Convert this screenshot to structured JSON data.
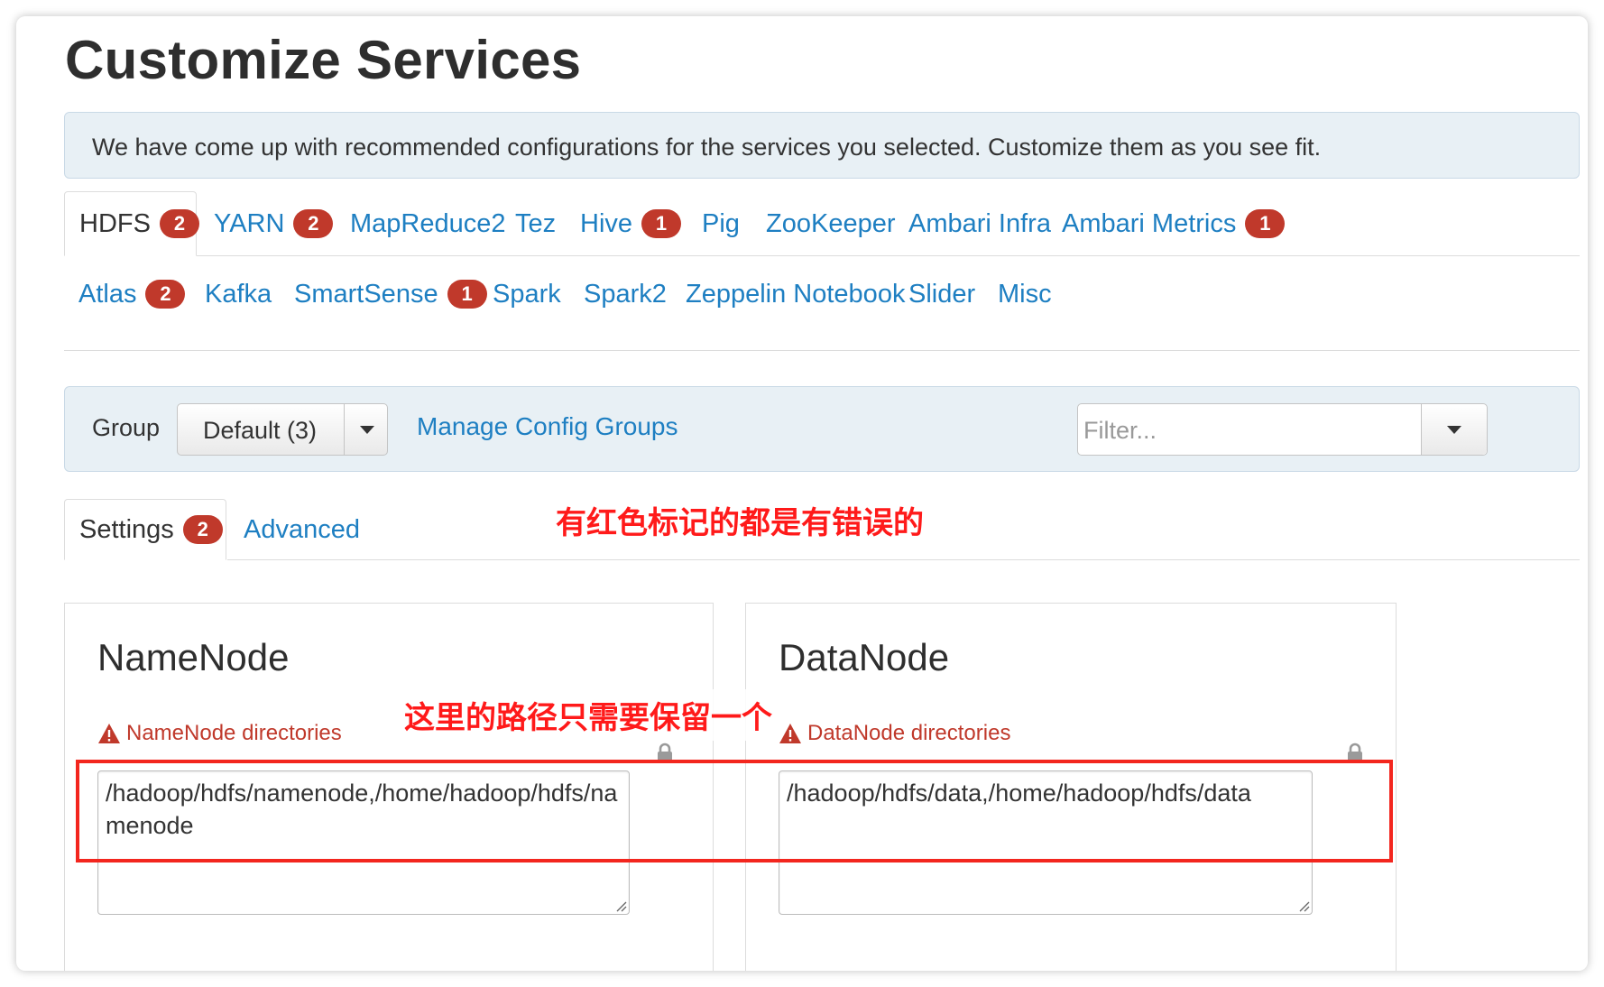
{
  "page_title": "Customize Services",
  "info_message": "We have come up with recommended configurations for the services you selected. Customize them as you see fit.",
  "service_tabs_row1": [
    {
      "label": "HDFS",
      "badge": "2",
      "active": true
    },
    {
      "label": "YARN",
      "badge": "2"
    },
    {
      "label": "MapReduce2",
      "badge": ""
    },
    {
      "label": "Tez",
      "badge": ""
    },
    {
      "label": "Hive",
      "badge": "1"
    },
    {
      "label": "Pig",
      "badge": ""
    },
    {
      "label": "ZooKeeper",
      "badge": ""
    },
    {
      "label": "Ambari Infra",
      "badge": ""
    },
    {
      "label": "Ambari Metrics",
      "badge": "1"
    }
  ],
  "service_tabs_row2": [
    {
      "label": "Atlas",
      "badge": "2"
    },
    {
      "label": "Kafka",
      "badge": ""
    },
    {
      "label": "SmartSense",
      "badge": "1"
    },
    {
      "label": "Spark",
      "badge": ""
    },
    {
      "label": "Spark2",
      "badge": ""
    },
    {
      "label": "Zeppelin Notebook",
      "badge": ""
    },
    {
      "label": "Slider",
      "badge": ""
    },
    {
      "label": "Misc",
      "badge": ""
    }
  ],
  "group_bar": {
    "label": "Group",
    "selected_group": "Default (3)",
    "manage_link": "Manage Config Groups",
    "filter_placeholder": "Filter..."
  },
  "annotations": {
    "top_note": "有红色标记的都是有错误的",
    "path_note": "这里的路径只需要保留一个",
    "highlight_color": "#f3261e"
  },
  "sub_tabs": {
    "settings_label": "Settings",
    "settings_badge": "2",
    "advanced_label": "Advanced"
  },
  "namenode": {
    "title": "NameNode",
    "error_label": "NameNode directories",
    "value": "/hadoop/hdfs/namenode,/home/hadoop/hdfs/namenode"
  },
  "datanode": {
    "title": "DataNode",
    "error_label": "DataNode directories",
    "value": "/hadoop/hdfs/data,/home/hadoop/hdfs/data"
  },
  "colors": {
    "link": "#1e7fc2",
    "badge": "#c0392b",
    "error": "#c0392b",
    "info_bg": "#e8f0f5"
  },
  "icons": [
    "warning-icon",
    "lock-icon",
    "caret-down-icon",
    "resize-grip-icon"
  ]
}
